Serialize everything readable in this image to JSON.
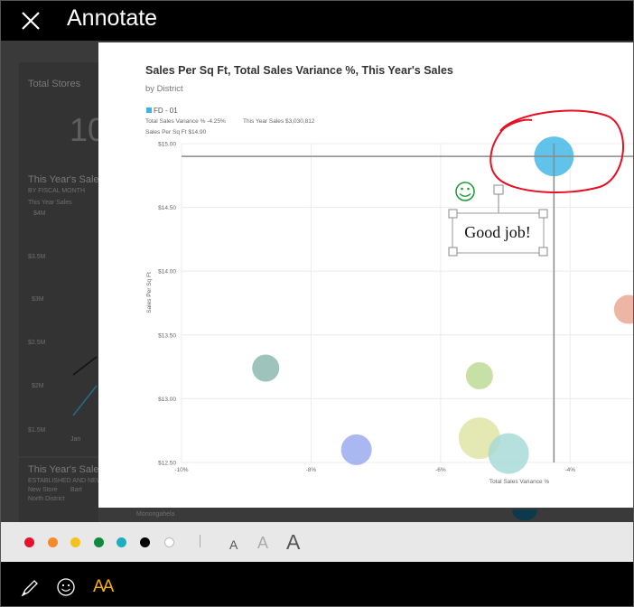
{
  "header": {
    "title": "Annotate",
    "close_icon": "close-icon"
  },
  "dashboard": {
    "tile1_title": "Total Stores",
    "tile1_value": "10",
    "tile2_title": "This Year's Sales",
    "tile2_subtitle": "BY FISCAL MONTH",
    "tile2_legend": "This Year Sales",
    "tile2_yticks": [
      "$4M",
      "$3.5M",
      "$3M",
      "$2.5M",
      "$2M",
      "$1.5M"
    ],
    "tile2_xlabel": "Jan",
    "tile3_title": "This Year's Sales",
    "tile3_subtitle": "ESTABLISHED AND NEW",
    "tile3_legend": "New Store",
    "tile3_extra": "Bart",
    "tile3_small": "North District",
    "tile3_map": "Monongahela"
  },
  "report": {
    "title": "Sales Per Sq Ft, Total Sales Variance %, This Year's Sales",
    "subtitle": "by District",
    "legend_item": "FD - 01",
    "legend_color": "#3bb4e5",
    "tooltip_line1": "Total Sales Variance % -4.25%",
    "tooltip_line2": "This Year Sales $3,030,812",
    "tooltip_line3": "Sales Per Sq Ft $14.90",
    "annotation_text": "Good job!",
    "smiley_icon": "smiley-icon"
  },
  "chart_data": {
    "type": "scatter",
    "title": "Sales Per Sq Ft, Total Sales Variance %, This Year's Sales",
    "subtitle": "by District",
    "xlabel": "Total Sales Variance %",
    "ylabel": "Sales Per Sq Ft",
    "x_ticks": [
      "-10%",
      "-8%",
      "-6%",
      "-4%"
    ],
    "y_ticks": [
      "$15.00",
      "$14.50",
      "$14.00",
      "$13.50",
      "$13.00",
      "$12.50"
    ],
    "xlim": [
      -10,
      -3
    ],
    "ylim": [
      12.5,
      15.0
    ],
    "reference_point": {
      "x": -4.25,
      "y": 14.9
    },
    "points": [
      {
        "x": -4.25,
        "y": 14.9,
        "size": 36,
        "color": "#3bb4e5"
      },
      {
        "x": -3.1,
        "y": 13.7,
        "size": 24,
        "color": "#e8a28d"
      },
      {
        "x": -8.7,
        "y": 13.24,
        "size": 22,
        "color": "#86b3ab"
      },
      {
        "x": -5.4,
        "y": 13.18,
        "size": 22,
        "color": "#b9d88f"
      },
      {
        "x": -7.3,
        "y": 12.6,
        "size": 26,
        "color": "#93a6ec"
      },
      {
        "x": -5.4,
        "y": 12.69,
        "size": 38,
        "color": "#dde4a1"
      },
      {
        "x": -4.95,
        "y": 12.57,
        "size": 37,
        "color": "#a4d8d6"
      }
    ],
    "grid": true
  },
  "toolbar": {
    "colors": [
      "#e8112d",
      "#f7892b",
      "#f5c21b",
      "#0f8a3d",
      "#1aafbf",
      "#000000",
      "#ffffff"
    ],
    "font_sizes": [
      "A",
      "A",
      "A"
    ],
    "pen_icon": "pen-icon",
    "emoji_icon": "smiley-icon",
    "text_icon": "text-size-icon",
    "text_icon_label": "AA",
    "accent": "#f7b500"
  }
}
